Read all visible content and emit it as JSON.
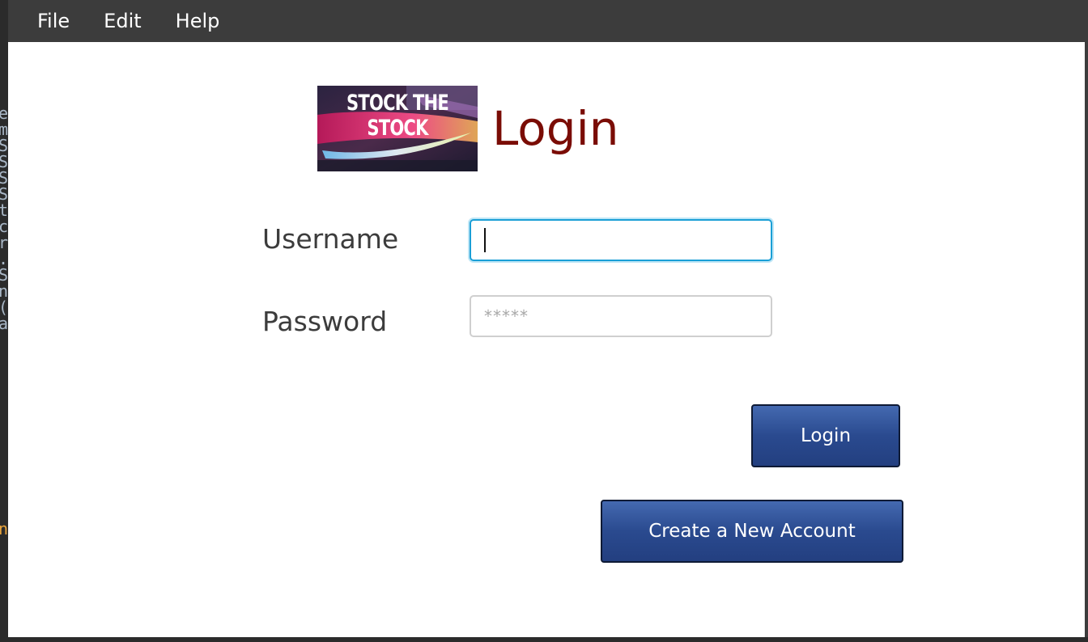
{
  "menu": {
    "file": "File",
    "edit": "Edit",
    "help": "Help"
  },
  "logo": {
    "line1": "STOCK THE",
    "line2": "STOCK"
  },
  "page_title": "Login",
  "form": {
    "username_label": "Username",
    "username_value": "",
    "password_label": "Password",
    "password_placeholder": "*****"
  },
  "buttons": {
    "login": "Login",
    "create_account": "Create a New Account"
  },
  "colors": {
    "title": "#7a0c05",
    "button": "#2a4a8f",
    "focus": "#1a9fd6",
    "menubar": "#3c3c3c"
  },
  "background_editor_chars": "e\nm\nS\nS\nS\nS\nt\nc\nr\n.\nS\nn\n(\na",
  "background_editor_char_orange": "n"
}
